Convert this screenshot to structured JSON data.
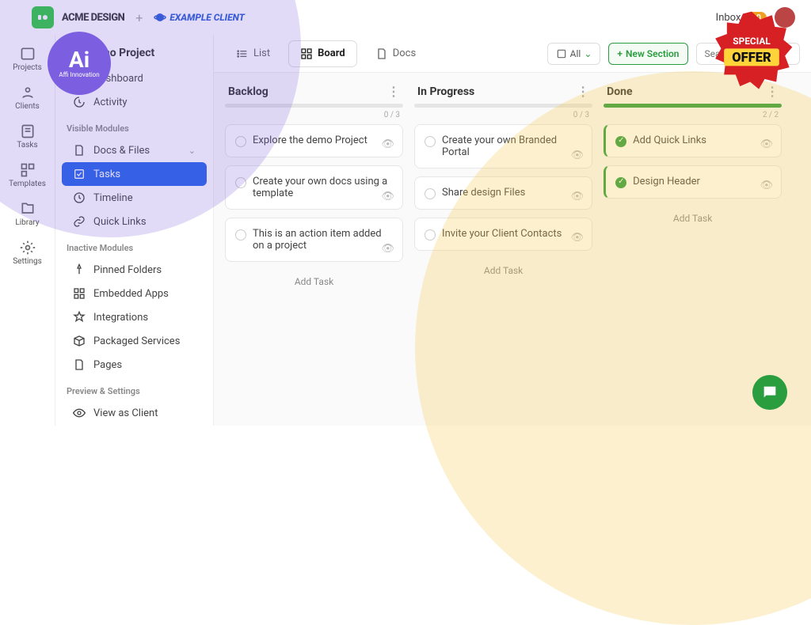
{
  "topbar": {
    "brand1": "ACME DESIGN",
    "brand2": "EXAMPLE CLIENT",
    "inbox_label": "Inbox",
    "inbox_count": "10"
  },
  "badges": {
    "ai_big": "Ai",
    "ai_small": "Affi Innovation",
    "offer_line1": "SPECIAL",
    "offer_line2": "OFFER"
  },
  "rail": {
    "items": [
      {
        "label": "Projects"
      },
      {
        "label": "Clients"
      },
      {
        "label": "Tasks"
      },
      {
        "label": "Templates"
      },
      {
        "label": "Library"
      },
      {
        "label": "Settings"
      }
    ]
  },
  "sidebar": {
    "project": "Demo Project",
    "items_top": [
      {
        "label": "Dashboard"
      },
      {
        "label": "Activity"
      }
    ],
    "section_visible": "Visible Modules",
    "items_visible": [
      {
        "label": "Docs & Files"
      },
      {
        "label": "Tasks"
      },
      {
        "label": "Timeline"
      },
      {
        "label": "Quick Links"
      }
    ],
    "section_inactive": "Inactive Modules",
    "items_inactive": [
      {
        "label": "Pinned Folders"
      },
      {
        "label": "Embedded Apps"
      },
      {
        "label": "Integrations"
      },
      {
        "label": "Packaged Services"
      },
      {
        "label": "Pages"
      }
    ],
    "section_preview": "Preview & Settings",
    "items_preview": [
      {
        "label": "View as Client"
      }
    ]
  },
  "toolbar": {
    "tabs": [
      {
        "label": "List"
      },
      {
        "label": "Board"
      },
      {
        "label": "Docs"
      }
    ],
    "filter_label": "All",
    "new_section": "New Section",
    "search_placeholder": "Search..."
  },
  "board": {
    "columns": [
      {
        "title": "Backlog",
        "progress": 0,
        "count": "0 / 3",
        "cards": [
          {
            "text": "Explore the demo Project",
            "done": false
          },
          {
            "text": "Create your own docs using a template",
            "done": false
          },
          {
            "text": "This is an action item added on a project",
            "done": false
          }
        ],
        "add": "Add Task"
      },
      {
        "title": "In Progress",
        "progress": 0,
        "count": "0 / 3",
        "cards": [
          {
            "text": "Create your own Branded Portal",
            "done": false
          },
          {
            "text": "Share design Files",
            "done": false
          },
          {
            "text": "Invite your Client Contacts",
            "done": false
          }
        ],
        "add": "Add Task"
      },
      {
        "title": "Done",
        "progress": 100,
        "count": "2 / 2",
        "cards": [
          {
            "text": "Add Quick Links",
            "done": true
          },
          {
            "text": "Design Header",
            "done": true
          }
        ],
        "add": "Add Task"
      }
    ]
  }
}
